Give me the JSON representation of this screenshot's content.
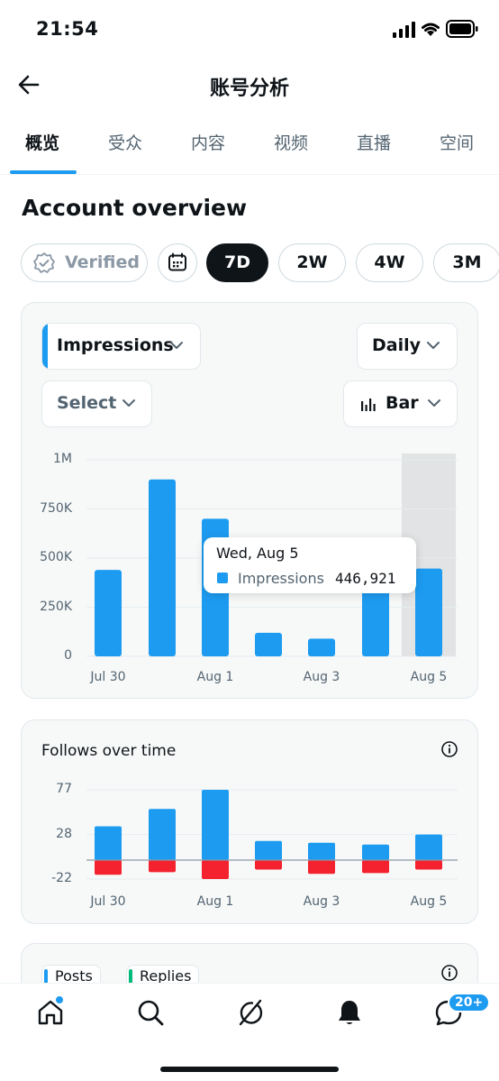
{
  "status_bar": {
    "time": "21:54"
  },
  "header": {
    "title": "账号分析",
    "back_icon": "arrow-left-icon"
  },
  "tabs": [
    {
      "label": "概览",
      "active": true
    },
    {
      "label": "受众",
      "active": false
    },
    {
      "label": "内容",
      "active": false
    },
    {
      "label": "视频",
      "active": false
    },
    {
      "label": "直播",
      "active": false
    },
    {
      "label": "空间",
      "active": false
    }
  ],
  "section_title": "Account overview",
  "filters": {
    "verified": "Verified",
    "ranges": [
      {
        "label": "7D",
        "selected": true
      },
      {
        "label": "2W",
        "selected": false
      },
      {
        "label": "4W",
        "selected": false
      },
      {
        "label": "3M",
        "selected": false
      }
    ]
  },
  "impressions_card": {
    "metric_dropdown": "Impressions",
    "interval_dropdown": "Daily",
    "compare_dropdown": "Select",
    "chart_type_dropdown": "Bar",
    "tooltip": {
      "date": "Wed, Aug 5",
      "series": "Impressions",
      "value": "446,921"
    }
  },
  "follows_card": {
    "title": "Follows over time"
  },
  "bottom_card": {
    "legend": [
      "Posts",
      "Replies"
    ]
  },
  "nav": {
    "badge": "20+"
  },
  "colors": {
    "accent": "#1d9bf0",
    "negative": "#f4212e",
    "text": "#0f1419",
    "muted": "#536471"
  },
  "chart_data": [
    {
      "type": "bar",
      "categories": [
        "Jul 30",
        "Jul 31",
        "Aug 1",
        "Aug 2",
        "Aug 3",
        "Aug 4",
        "Aug 5"
      ],
      "series": [
        {
          "name": "Impressions",
          "values": [
            440000,
            900000,
            700000,
            120000,
            90000,
            390000,
            446921
          ]
        }
      ],
      "xticks": [
        "Jul 30",
        "Aug 1",
        "Aug 3",
        "Aug 5"
      ],
      "yticks": [
        "0",
        "250K",
        "500K",
        "750K",
        "1M"
      ],
      "ylim": [
        0,
        1000000
      ],
      "grid": true,
      "highlighted_category": "Aug 5"
    },
    {
      "type": "bar",
      "categories": [
        "Jul 30",
        "Jul 31",
        "Aug 1",
        "Aug 2",
        "Aug 3",
        "Aug 4",
        "Aug 5"
      ],
      "series": [
        {
          "values": [
            37,
            56,
            77,
            21,
            19,
            17,
            28
          ]
        },
        {
          "values": [
            -17,
            -14,
            -22,
            -11,
            -16,
            -15,
            -11
          ]
        }
      ],
      "xticks": [
        "Jul 30",
        "Aug 1",
        "Aug 3",
        "Aug 5"
      ],
      "yticks": [
        "77",
        "28",
        "-22"
      ],
      "ylim": [
        -22,
        77
      ],
      "grid": true
    }
  ]
}
